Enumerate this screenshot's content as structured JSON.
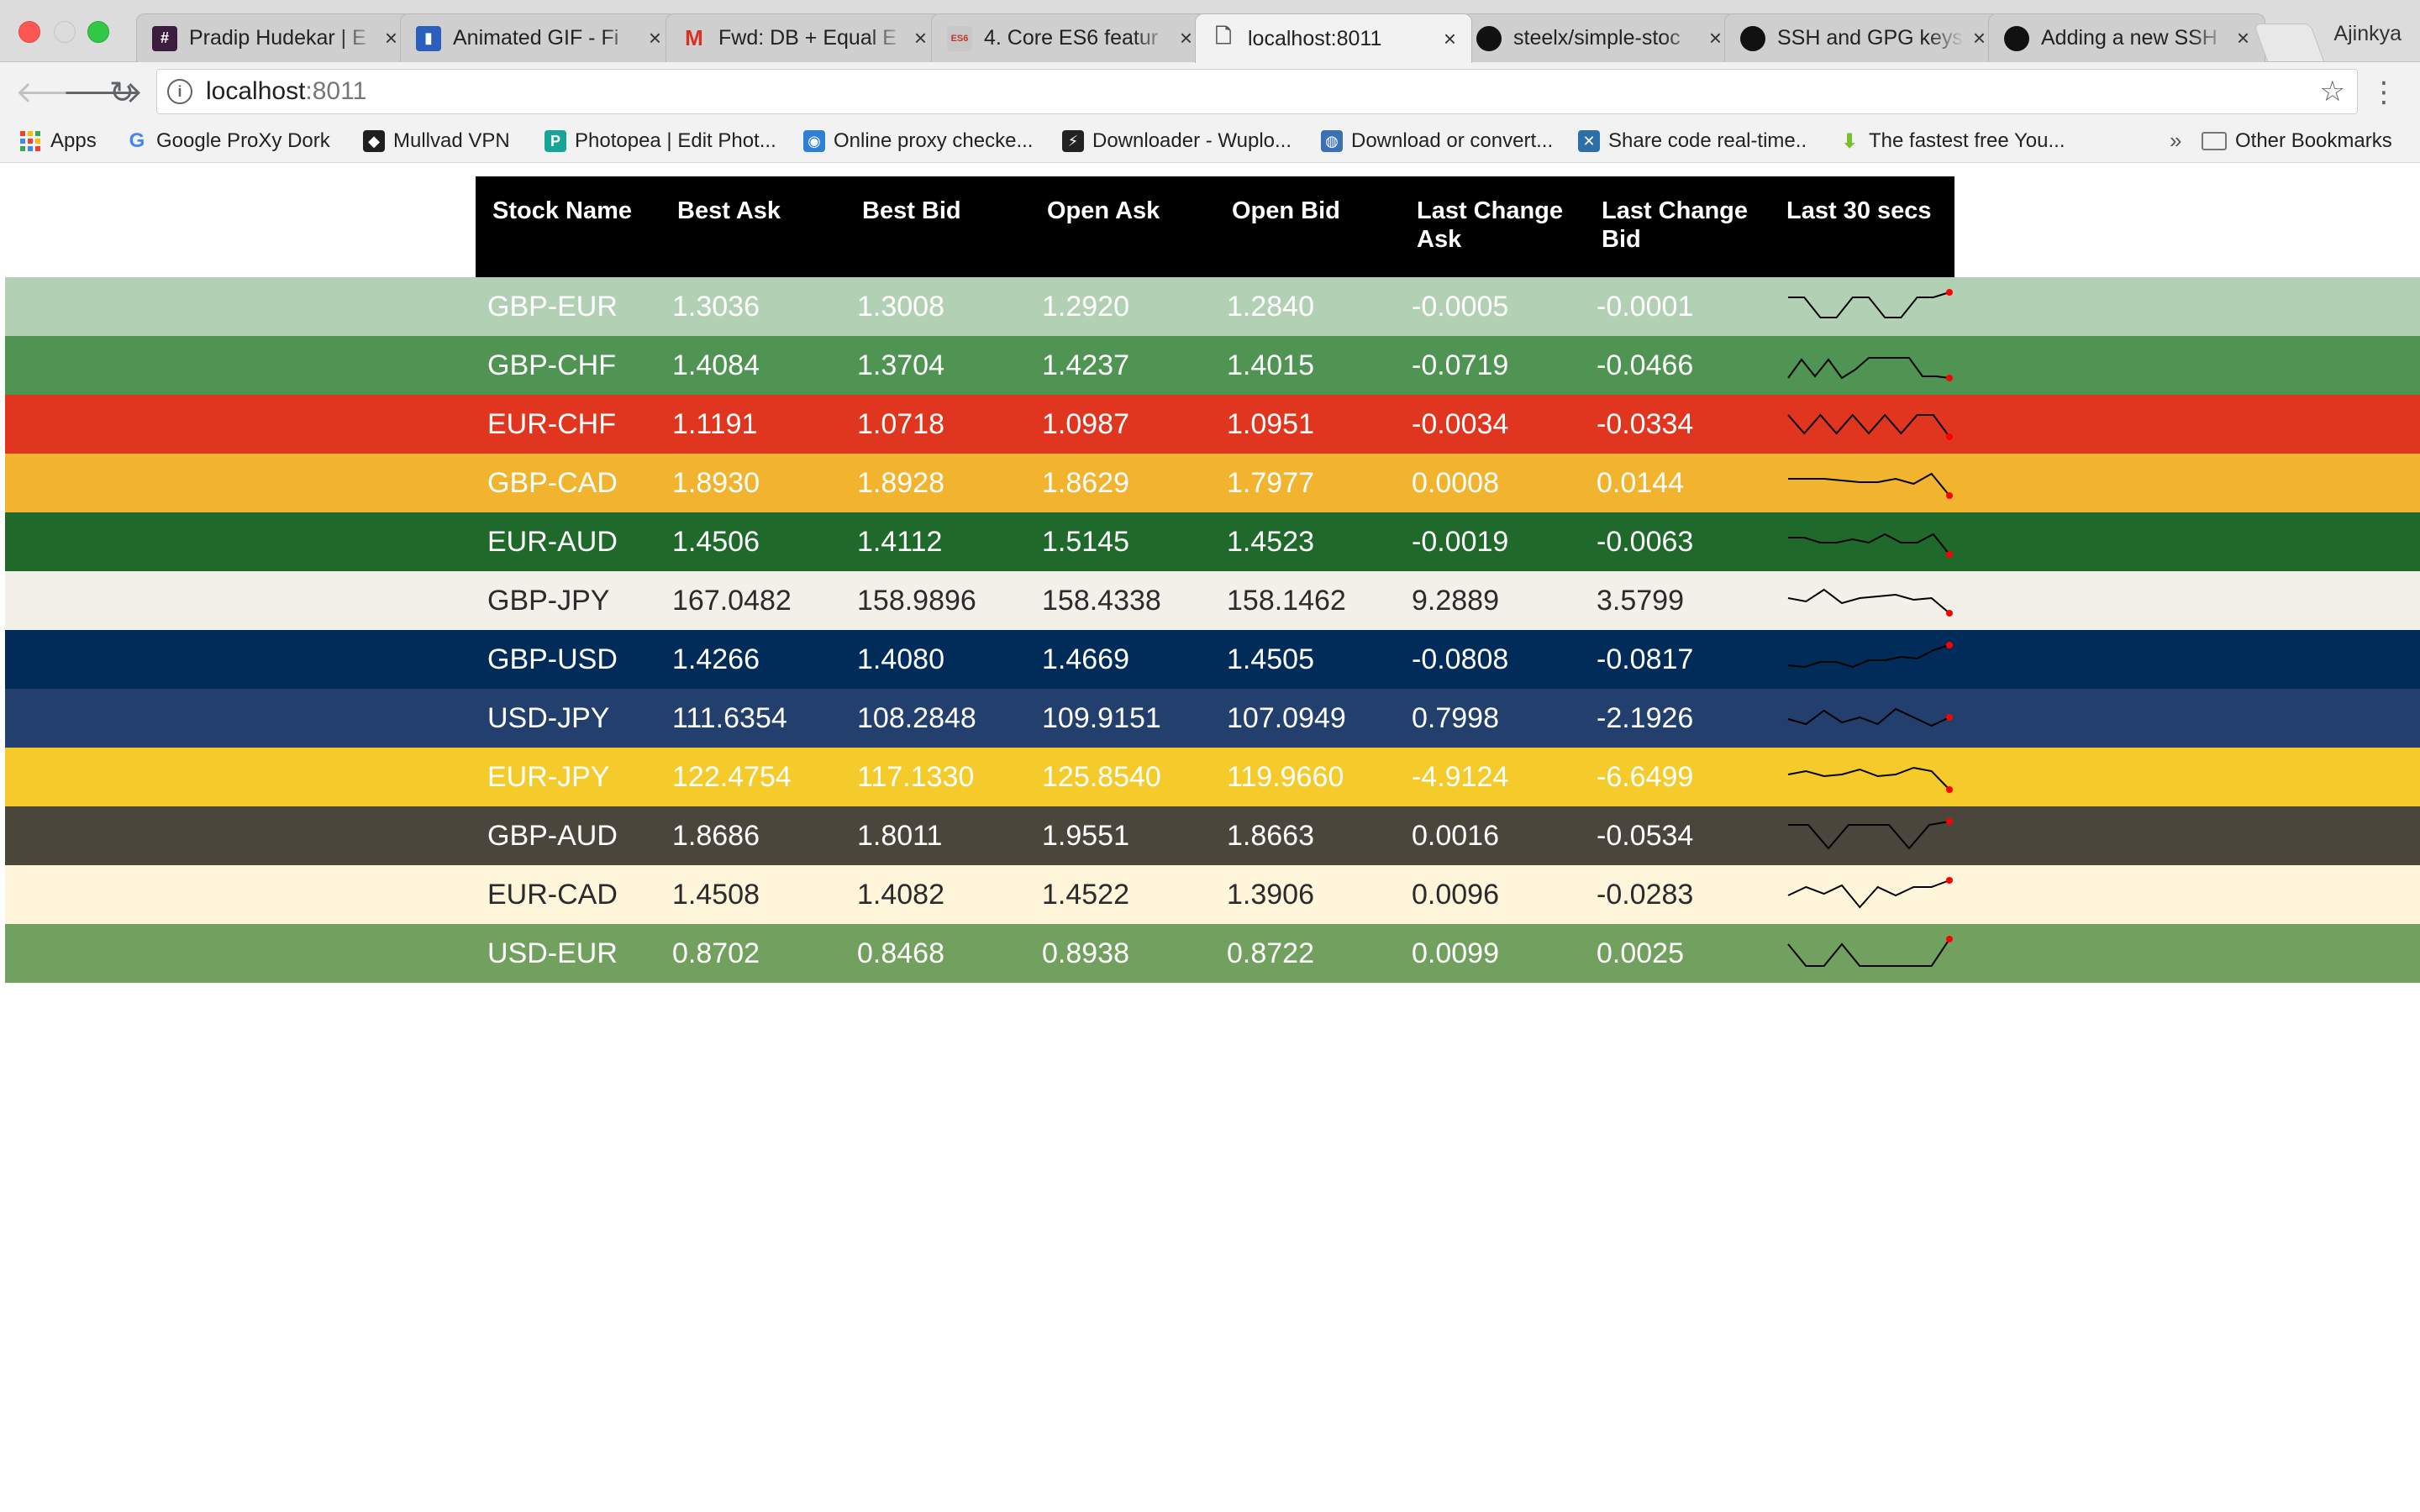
{
  "browser": {
    "tabs": [
      {
        "title": "Pradip Hudekar | E",
        "favicon": "slack-icon",
        "color": "#3d1d3f",
        "glyph": "#"
      },
      {
        "title": "Animated GIF - Fi",
        "favicon": "gif-icon",
        "color": "#2b5fbd",
        "glyph": "▮"
      },
      {
        "title": "Fwd: DB + Equal E",
        "favicon": "gmail-icon",
        "color": "#ffffff",
        "glyph": "M"
      },
      {
        "title": "4. Core ES6 featur",
        "favicon": "es6-icon",
        "color": "#c8c8c8",
        "glyph": "ES6"
      },
      {
        "title": "localhost:8011",
        "favicon": "page-icon",
        "color": "#ffffff",
        "glyph": "🗋"
      },
      {
        "title": "steelx/simple-stoc",
        "favicon": "github-icon",
        "color": "#111111",
        "glyph": "●"
      },
      {
        "title": "SSH and GPG keys",
        "favicon": "github-icon",
        "color": "#111111",
        "glyph": "●"
      },
      {
        "title": "Adding a new SSH",
        "favicon": "github-icon",
        "color": "#111111",
        "glyph": "●"
      }
    ],
    "active_tab": 4,
    "close_glyph": "×",
    "profile": "Ajinkya",
    "url_host": "localhost",
    "url_port": ":8011",
    "bookmarks": [
      {
        "label": "Apps",
        "icon": "apps-grid-icon"
      },
      {
        "label": "Google ProXy Dork",
        "icon": "google-icon",
        "glyph": "G",
        "color": "#4285f4"
      },
      {
        "label": "Mullvad VPN",
        "icon": "mullvad-icon",
        "glyph": "◆",
        "color": "#1f1f1f"
      },
      {
        "label": "Photopea | Edit Phot...",
        "icon": "photopea-icon",
        "glyph": "P",
        "color": "#18a497"
      },
      {
        "label": "Online proxy checke...",
        "icon": "proxy-icon",
        "glyph": "◉",
        "color": "#2f7fd8"
      },
      {
        "label": "Downloader - Wuplo...",
        "icon": "downloader-icon",
        "glyph": "⚡",
        "color": "#222222"
      },
      {
        "label": "Download or convert...",
        "icon": "globe-icon",
        "glyph": "◍",
        "color": "#3b6fb6"
      },
      {
        "label": "Share code real-time..",
        "icon": "share-code-icon",
        "glyph": "✕",
        "color": "#2c6fa8"
      },
      {
        "label": "The fastest free You...",
        "icon": "download-arrow-icon",
        "glyph": "⬇",
        "color": "#78c02a"
      }
    ],
    "bookmarks_more": "»",
    "other_bookmarks": "Other Bookmarks"
  },
  "table": {
    "headers": [
      "Stock Name",
      "Best Ask",
      "Best Bid",
      "Open Ask",
      "Open Bid",
      "Last Change Ask",
      "Last Change Bid",
      "Last 30 secs"
    ],
    "rows": [
      {
        "name": "GBP-EUR",
        "best_ask": "1.3036",
        "best_bid": "1.3008",
        "open_ask": "1.2920",
        "open_bid": "1.2840",
        "lca": "-0.0005",
        "lcb": "-0.0001",
        "bg": "#b2d1b4",
        "fg": "#ffffff",
        "spark": [
          0.2,
          0.2,
          0.8,
          0.8,
          0.2,
          0.2,
          0.8,
          0.8,
          0.2,
          0.2,
          0.05
        ]
      },
      {
        "name": "GBP-CHF",
        "best_ask": "1.4084",
        "best_bid": "1.3704",
        "open_ask": "1.4237",
        "open_bid": "1.4015",
        "lca": "-0.0719",
        "lcb": "-0.0466",
        "bg": "#4f9452",
        "fg": "#ffffff",
        "spark": [
          0.85,
          0.3,
          0.8,
          0.3,
          0.85,
          0.6,
          0.25,
          0.25,
          0.25,
          0.25,
          0.8,
          0.8,
          0.85
        ]
      },
      {
        "name": "EUR-CHF",
        "best_ask": "1.1191",
        "best_bid": "1.0718",
        "open_ask": "1.0987",
        "open_bid": "1.0951",
        "lca": "-0.0034",
        "lcb": "-0.0334",
        "bg": "#e03620",
        "fg": "#ffffff",
        "spark": [
          0.2,
          0.75,
          0.2,
          0.75,
          0.2,
          0.75,
          0.2,
          0.75,
          0.2,
          0.2,
          0.85
        ]
      },
      {
        "name": "GBP-CAD",
        "best_ask": "1.8930",
        "best_bid": "1.8928",
        "open_ask": "1.8629",
        "open_bid": "1.7977",
        "lca": "0.0008",
        "lcb": "0.0144",
        "bg": "#f2b42e",
        "fg": "#ffffff",
        "spark": [
          0.35,
          0.35,
          0.35,
          0.4,
          0.45,
          0.45,
          0.35,
          0.5,
          0.2,
          0.85
        ]
      },
      {
        "name": "EUR-AUD",
        "best_ask": "1.4506",
        "best_bid": "1.4112",
        "open_ask": "1.5145",
        "open_bid": "1.4523",
        "lca": "-0.0019",
        "lcb": "-0.0063",
        "bg": "#1f6a2b",
        "fg": "#ffffff",
        "spark": [
          0.35,
          0.35,
          0.5,
          0.5,
          0.4,
          0.5,
          0.25,
          0.5,
          0.5,
          0.25,
          0.85
        ]
      },
      {
        "name": "GBP-JPY",
        "best_ask": "167.0482",
        "best_bid": "158.9896",
        "open_ask": "158.4338",
        "open_bid": "158.1462",
        "lca": "9.2889",
        "lcb": "3.5799",
        "bg": "#f3f0ea",
        "fg": "#2b2b2b",
        "spark": [
          0.4,
          0.5,
          0.15,
          0.55,
          0.4,
          0.35,
          0.3,
          0.45,
          0.4,
          0.85
        ]
      },
      {
        "name": "GBP-USD",
        "best_ask": "1.4266",
        "best_bid": "1.4080",
        "open_ask": "1.4669",
        "open_bid": "1.4505",
        "lca": "-0.0808",
        "lcb": "-0.0817",
        "bg": "#012c59",
        "fg": "#ffffff",
        "spark": [
          0.65,
          0.7,
          0.55,
          0.55,
          0.7,
          0.5,
          0.5,
          0.4,
          0.45,
          0.2,
          0.05
        ]
      },
      {
        "name": "USD-JPY",
        "best_ask": "111.6354",
        "best_bid": "108.2848",
        "open_ask": "109.9151",
        "open_bid": "107.0949",
        "lca": "0.7998",
        "lcb": "-2.1926",
        "bg": "#223f6d",
        "fg": "#ffffff",
        "spark": [
          0.5,
          0.65,
          0.25,
          0.6,
          0.45,
          0.65,
          0.2,
          0.45,
          0.7,
          0.45
        ]
      },
      {
        "name": "EUR-JPY",
        "best_ask": "122.4754",
        "best_bid": "117.1330",
        "open_ask": "125.8540",
        "open_bid": "119.9660",
        "lca": "-4.9124",
        "lcb": "-6.6499",
        "bg": "#f4cb2a",
        "fg": "#ffffff",
        "spark": [
          0.4,
          0.3,
          0.45,
          0.4,
          0.25,
          0.45,
          0.4,
          0.2,
          0.3,
          0.85
        ]
      },
      {
        "name": "GBP-AUD",
        "best_ask": "1.8686",
        "best_bid": "1.8011",
        "open_ask": "1.9551",
        "open_bid": "1.8663",
        "lca": "0.0016",
        "lcb": "-0.0534",
        "bg": "#4a463b",
        "fg": "#ffffff",
        "spark": [
          0.15,
          0.15,
          0.85,
          0.15,
          0.15,
          0.15,
          0.85,
          0.15,
          0.05
        ]
      },
      {
        "name": "EUR-CAD",
        "best_ask": "1.4508",
        "best_bid": "1.4082",
        "open_ask": "1.4522",
        "open_bid": "1.3906",
        "lca": "0.0096",
        "lcb": "-0.0283",
        "bg": "#fef5db",
        "fg": "#2b2b2b",
        "spark": [
          0.5,
          0.25,
          0.45,
          0.2,
          0.85,
          0.25,
          0.5,
          0.25,
          0.25,
          0.05
        ]
      },
      {
        "name": "USD-EUR",
        "best_ask": "0.8702",
        "best_bid": "0.8468",
        "open_ask": "0.8938",
        "open_bid": "0.8722",
        "lca": "0.0099",
        "lcb": "0.0025",
        "bg": "#72a05f",
        "fg": "#ffffff",
        "spark": [
          0.2,
          0.85,
          0.85,
          0.2,
          0.85,
          0.85,
          0.85,
          0.85,
          0.85,
          0.05
        ]
      }
    ],
    "sparkline_stroke": "#000000",
    "sparkline_marker": "#ff0000"
  }
}
